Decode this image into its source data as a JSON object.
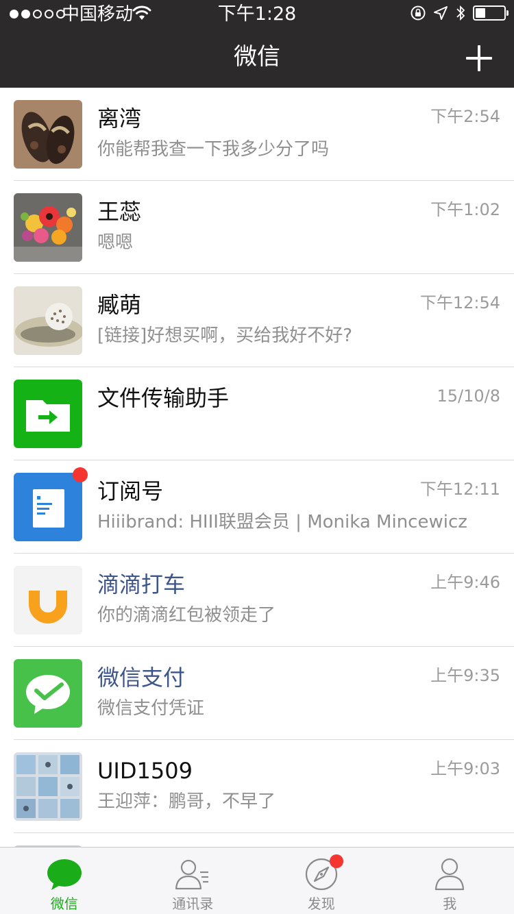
{
  "status_bar": {
    "carrier": "中国移动",
    "time": "下午1:28",
    "signal_bars": 5,
    "signal_filled": 2,
    "battery_level": 0.35
  },
  "nav": {
    "title": "微信",
    "add_icon": "plus-icon"
  },
  "chats": [
    {
      "name": "离湾",
      "message": "你能帮我查一下我多少分了吗",
      "time": "下午2:54",
      "avatar": "sandals-photo",
      "name_style": "default",
      "unread_dot": false
    },
    {
      "name": "王蕊",
      "message": "嗯嗯",
      "time": "下午1:02",
      "avatar": "bouquet-photo",
      "name_style": "default",
      "unread_dot": false
    },
    {
      "name": "臧萌",
      "message": "[链接]好想买啊，买给我好不好?",
      "time": "下午12:54",
      "avatar": "ornament-photo",
      "name_style": "default",
      "unread_dot": false
    },
    {
      "name": "文件传输助手",
      "message": "",
      "time": "15/10/8",
      "avatar": "file-transfer-icon",
      "name_style": "default",
      "unread_dot": false
    },
    {
      "name": "订阅号",
      "message": "Hiiibrand: HIII联盟会员 | Monika Mincewicz",
      "time": "下午12:11",
      "avatar": "subscription-icon",
      "name_style": "default",
      "unread_dot": true
    },
    {
      "name": "滴滴打车",
      "message": "你的滴滴红包被领走了",
      "time": "上午9:46",
      "avatar": "didi-logo",
      "name_style": "official",
      "unread_dot": false
    },
    {
      "name": "微信支付",
      "message": "微信支付凭证",
      "time": "上午9:35",
      "avatar": "wechat-pay-logo",
      "name_style": "official",
      "unread_dot": false
    },
    {
      "name": "UID1509",
      "message": "王迎萍：鹏哥，不早了",
      "time": "上午9:03",
      "avatar": "photo-grid",
      "name_style": "default",
      "unread_dot": false
    }
  ],
  "tabs": [
    {
      "label": "微信",
      "icon": "chat-bubble-icon",
      "active": true,
      "dot": false
    },
    {
      "label": "通讯录",
      "icon": "contacts-icon",
      "active": false,
      "dot": false
    },
    {
      "label": "发现",
      "icon": "compass-icon",
      "active": false,
      "dot": true
    },
    {
      "label": "我",
      "icon": "person-icon",
      "active": false,
      "dot": false
    }
  ],
  "colors": {
    "nav_bg": "#2d2a2b",
    "accent": "#1aad19",
    "official_name": "#3d5589",
    "badge": "#f43530",
    "muted_text": "#8f8f8f"
  }
}
